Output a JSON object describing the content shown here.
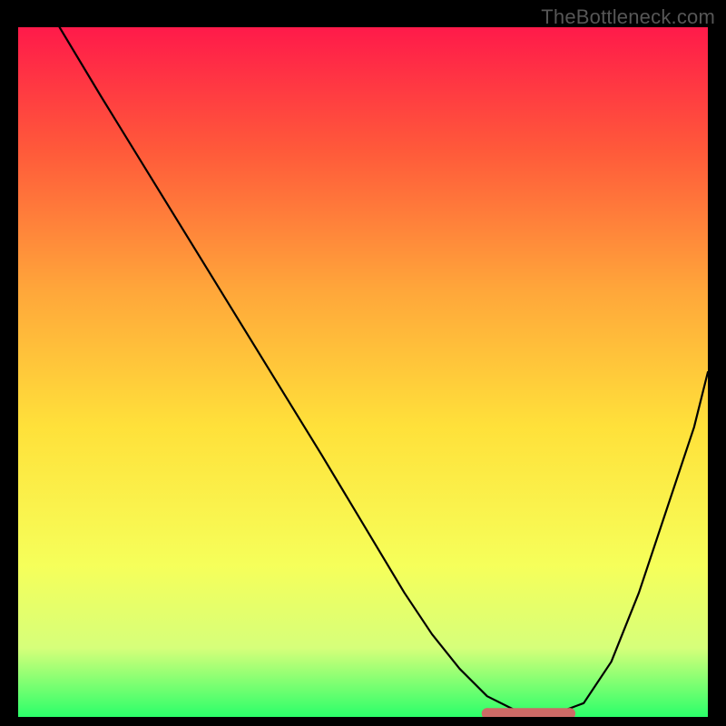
{
  "watermark": "TheBottleneck.com",
  "colors": {
    "frame": "#000000",
    "gradient_top": "#ff1a4a",
    "gradient_mid1": "#ff5a3a",
    "gradient_mid2": "#ffa63a",
    "gradient_mid3": "#ffe13a",
    "gradient_mid4": "#f6ff5a",
    "gradient_mid5": "#d6ff7a",
    "gradient_bottom": "#2bff6a",
    "curve": "#000000",
    "highlight": "#cc6a66"
  },
  "chart_data": {
    "type": "line",
    "title": "",
    "xlabel": "",
    "ylabel": "",
    "xlim": [
      0,
      100
    ],
    "ylim": [
      0,
      100
    ],
    "series": [
      {
        "name": "bottleneck-curve",
        "x": [
          6,
          12,
          20,
          28,
          36,
          44,
          50,
          56,
          60,
          64,
          68,
          72,
          76,
          78,
          82,
          86,
          90,
          94,
          98,
          100
        ],
        "y": [
          100,
          90,
          77,
          64,
          51,
          38,
          28,
          18,
          12,
          7,
          3,
          1,
          0.5,
          0.5,
          2,
          8,
          18,
          30,
          42,
          50
        ]
      }
    ],
    "highlight_segment": {
      "x_start": 68,
      "x_end": 80,
      "y": 0.5
    },
    "annotations": []
  }
}
